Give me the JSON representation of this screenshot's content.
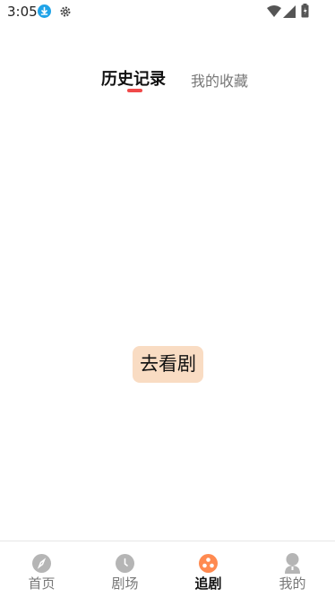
{
  "status_bar": {
    "time": "3:05",
    "icons": [
      "download-icon",
      "gear-icon",
      "wifi-icon",
      "signal-icon",
      "battery-icon"
    ]
  },
  "tabs": [
    {
      "label": "历史记录",
      "active": true
    },
    {
      "label": "我的收藏",
      "active": false
    }
  ],
  "main": {
    "action_label": "去看剧"
  },
  "bottom_nav": {
    "items": [
      {
        "label": "首页",
        "icon": "compass-icon",
        "active": false
      },
      {
        "label": "剧场",
        "icon": "clock-icon",
        "active": false
      },
      {
        "label": "追剧",
        "icon": "follow-icon",
        "active": true
      },
      {
        "label": "我的",
        "icon": "profile-icon",
        "active": false
      }
    ]
  },
  "colors": {
    "accent_indicator": "#f04a4a",
    "button_bg": "#f9dcc3",
    "active_nav_icon": "#ff8a50",
    "inactive_nav_icon": "#b5b5b5",
    "download_badge": "#1fa3e8"
  }
}
